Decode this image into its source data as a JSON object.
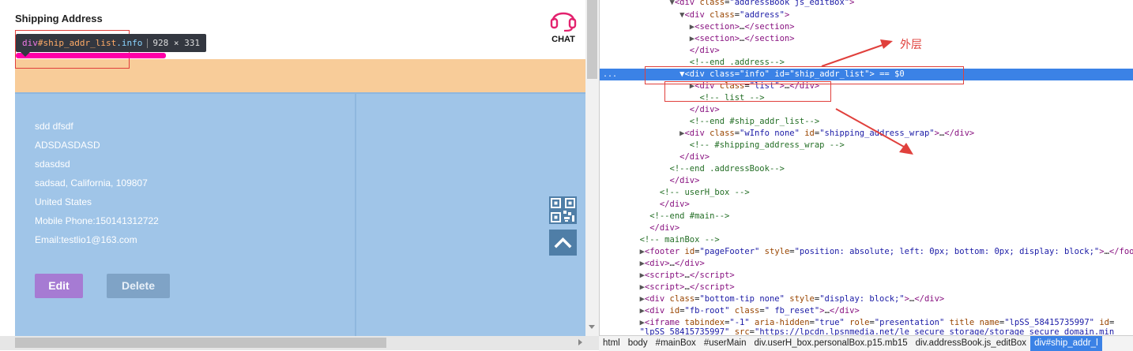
{
  "page": {
    "heading": "Shipping Address",
    "chat_label": "CHAT",
    "tooltip": {
      "tag": "div",
      "id": "#ship_addr_list",
      "cls": ".info",
      "size": "928 × 331"
    },
    "address_lines": [
      "sdd dfsdf",
      "ADSDASDASD",
      "sdasdsd",
      "sadsad, California, 109807",
      "United States",
      "Mobile Phone:150141312722",
      "Email:testlio1@163.com"
    ],
    "edit_label": "Edit",
    "delete_label": "Delete"
  },
  "devtools": {
    "annotation": "外层",
    "dots": "...",
    "breadcrumbs": [
      "html",
      "body",
      "#mainBox",
      "#userMain",
      "div.userH_box.personalBox.p15.mb15",
      "div.addressBook.js_editBox",
      "div#ship_addr_l"
    ],
    "active_crumb_index": 6
  },
  "colors": {
    "margin_highlight": "#f8cc99",
    "content_highlight": "#a0c5e8",
    "selection": "#3b82e6",
    "annotation_red": "#e0403c",
    "edit_button": "#a67bd3",
    "chat_icon": "#e3226e"
  },
  "icons": {
    "chat": "headset-icon",
    "qr": "qr-code-icon",
    "up": "chevron-up-icon"
  }
}
